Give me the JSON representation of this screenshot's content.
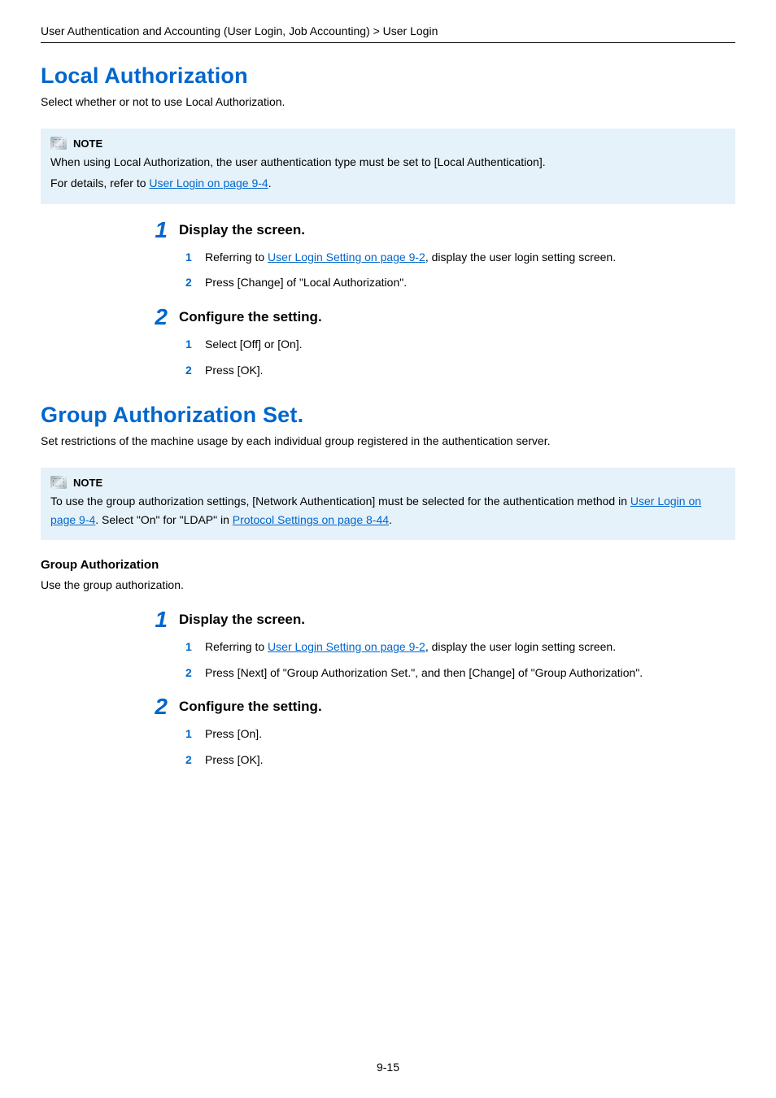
{
  "breadcrumb": "User Authentication and Accounting (User Login, Job Accounting) > User Login",
  "section1": {
    "title": "Local Authorization",
    "intro": "Select whether or not to use Local Authorization.",
    "note": {
      "label": "NOTE",
      "line1": "When using Local Authorization, the user authentication type must be set to [Local Authentication].",
      "line2_pre": "For details, refer to ",
      "line2_link": "User Login on page 9-4",
      "line2_post": "."
    },
    "step1": {
      "num": "1",
      "title": "Display the screen.",
      "sub1": {
        "num": "1",
        "pre": "Referring to ",
        "link": "User Login Setting on page 9-2",
        "post": ", display the user login setting screen."
      },
      "sub2": {
        "num": "2",
        "text": "Press [Change] of \"Local Authorization\"."
      }
    },
    "step2": {
      "num": "2",
      "title": "Configure the setting.",
      "sub1": {
        "num": "1",
        "text": "Select [Off] or [On]."
      },
      "sub2": {
        "num": "2",
        "text": "Press [OK]."
      }
    }
  },
  "section2": {
    "title": "Group Authorization Set.",
    "intro": "Set restrictions of the machine usage by each individual group registered in the authentication server.",
    "note": {
      "label": "NOTE",
      "line1_pre": "To use the group authorization settings, [Network Authentication] must be selected for the authentication method in ",
      "line1_link1": "User Login on page 9-4",
      "line1_mid": ". Select \"On\" for \"LDAP\" in ",
      "line1_link2": "Protocol Settings on page 8-44",
      "line1_post": "."
    },
    "subheader": "Group Authorization",
    "subintro": "Use the group authorization.",
    "step1": {
      "num": "1",
      "title": "Display the screen.",
      "sub1": {
        "num": "1",
        "pre": "Referring to ",
        "link": "User Login Setting on page 9-2",
        "post": ", display the user login setting screen."
      },
      "sub2": {
        "num": "2",
        "text": "Press [Next] of \"Group Authorization Set.\", and then [Change] of \"Group Authorization\"."
      }
    },
    "step2": {
      "num": "2",
      "title": "Configure the setting.",
      "sub1": {
        "num": "1",
        "text": "Press [On]."
      },
      "sub2": {
        "num": "2",
        "text": "Press [OK]."
      }
    }
  },
  "page_number": "9-15"
}
